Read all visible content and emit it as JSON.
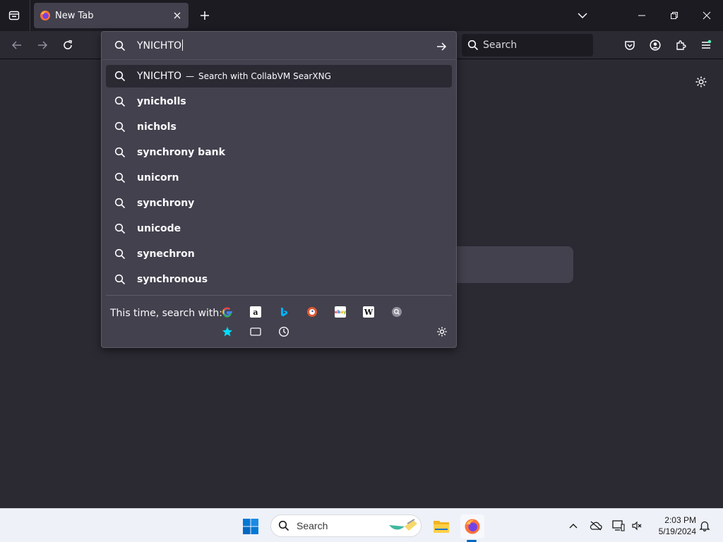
{
  "tab": {
    "title": "New Tab"
  },
  "toolbar": {
    "search_placeholder": "Search"
  },
  "urlbar": {
    "value": "YNICHTO",
    "results": [
      {
        "text": "YNICHTO",
        "separator": "—",
        "action": "Search with CollabVM SearXNG",
        "selected": true,
        "bold": false
      },
      {
        "text": "ynicholls",
        "bold": true
      },
      {
        "text": "nichols",
        "bold": true
      },
      {
        "text": "synchrony bank",
        "bold": true
      },
      {
        "text": "unicorn",
        "bold": true
      },
      {
        "text": "synchrony",
        "bold": true
      },
      {
        "text": "unicode",
        "bold": true
      },
      {
        "text": "synechron",
        "bold": true
      },
      {
        "text": "synchronous",
        "bold": true
      }
    ],
    "oneoff_label": "This time, search with:",
    "engines": [
      "google-icon",
      "amazon-icon",
      "bing-icon",
      "duckduckgo-icon",
      "ebay-icon",
      "wikipedia-icon",
      "searxng-icon",
      "bookmarks-icon",
      "tabs-icon",
      "history-icon"
    ]
  },
  "taskbar": {
    "search_placeholder": "Search",
    "time": "2:03 PM",
    "date": "5/19/2024"
  },
  "colors": {
    "toolbar_bg": "#2b2a33",
    "tabstrip_bg": "#1c1b22",
    "popup_bg": "#42414d",
    "accent_blue": "#0067c0",
    "bookmark_star": "#00ddff"
  }
}
